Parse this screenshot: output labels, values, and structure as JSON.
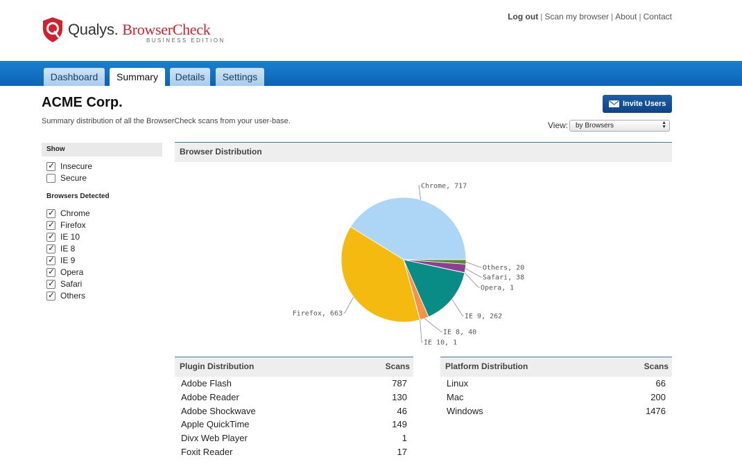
{
  "brand": {
    "name": "Qualys.",
    "product": "BrowserCheck",
    "edition": "BUSINESS EDITION"
  },
  "toplinks": {
    "logout": "Log out",
    "scan": "Scan my browser",
    "about": "About",
    "contact": "Contact",
    "separator": "|"
  },
  "tabs": [
    {
      "label": "Dashboard",
      "active": false
    },
    {
      "label": "Summary",
      "active": true
    },
    {
      "label": "Details",
      "active": false
    },
    {
      "label": "Settings",
      "active": false
    }
  ],
  "page": {
    "title": "ACME Corp.",
    "subtitle": "Summary distribution of all the BrowserCheck scans from your user-base."
  },
  "invite_button": "Invite Users",
  "view": {
    "label": "View:",
    "selected": "by Browsers"
  },
  "sidebar": {
    "show_heading": "Show",
    "show_items": [
      {
        "label": "Insecure",
        "checked": true
      },
      {
        "label": "Secure",
        "checked": false
      }
    ],
    "browsers_heading": "Browsers Detected",
    "browser_items": [
      {
        "label": "Chrome",
        "checked": true
      },
      {
        "label": "Firefox",
        "checked": true
      },
      {
        "label": "IE 10",
        "checked": true
      },
      {
        "label": "IE 8",
        "checked": true
      },
      {
        "label": "IE 9",
        "checked": true
      },
      {
        "label": "Opera",
        "checked": true
      },
      {
        "label": "Safari",
        "checked": true
      },
      {
        "label": "Others",
        "checked": true
      }
    ]
  },
  "browser_section": {
    "title": "Browser Distribution"
  },
  "chart_data": {
    "type": "pie",
    "title": "Browser Distribution",
    "slices": [
      {
        "label": "Chrome",
        "value": 717,
        "color": "#add5f5"
      },
      {
        "label": "Others",
        "value": 20,
        "color": "#5d8a2a"
      },
      {
        "label": "Safari",
        "value": 38,
        "color": "#8e3f93"
      },
      {
        "label": "Opera",
        "value": 1,
        "color": "#c6c6c6"
      },
      {
        "label": "IE 9",
        "value": 262,
        "color": "#0a8c86"
      },
      {
        "label": "IE 8",
        "value": 40,
        "color": "#f5934a"
      },
      {
        "label": "IE 10",
        "value": 1,
        "color": "#6d6d6d"
      },
      {
        "label": "Firefox",
        "value": 663,
        "color": "#f5ba0f"
      }
    ],
    "label_texts": [
      "Chrome, 717",
      "Others, 20",
      "Safari, 38",
      "Opera, 1",
      "IE 9, 262",
      "IE 8, 40",
      "IE 10, 1",
      "Firefox, 663"
    ]
  },
  "plugin_table": {
    "title": "Plugin Distribution",
    "col_header": "Scans",
    "rows": [
      {
        "name": "Adobe Flash",
        "value": "787"
      },
      {
        "name": "Adobe Reader",
        "value": "130"
      },
      {
        "name": "Adobe Shockwave",
        "value": "46"
      },
      {
        "name": "Apple QuickTime",
        "value": "149"
      },
      {
        "name": "Divx Web Player",
        "value": "1"
      },
      {
        "name": "Foxit Reader",
        "value": "17"
      }
    ]
  },
  "platform_table": {
    "title": "Platform Distribution",
    "col_header": "Scans",
    "rows": [
      {
        "name": "Linux",
        "value": "66"
      },
      {
        "name": "Mac",
        "value": "200"
      },
      {
        "name": "Windows",
        "value": "1476"
      }
    ]
  }
}
